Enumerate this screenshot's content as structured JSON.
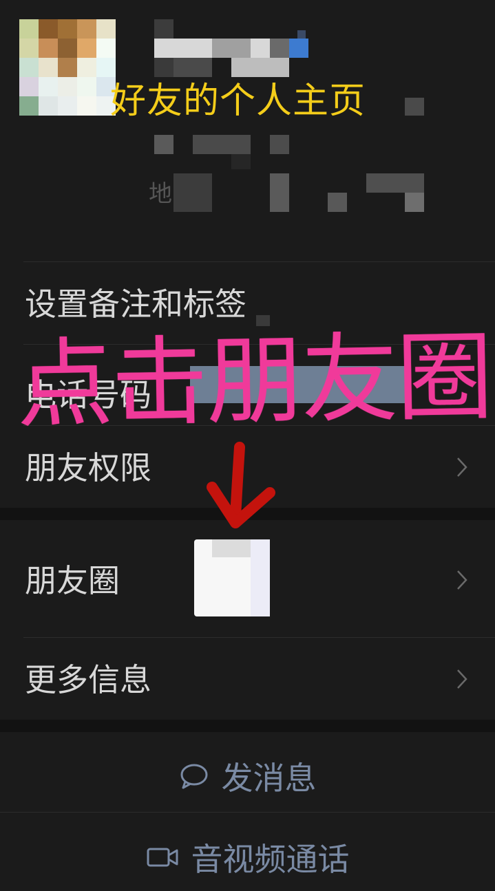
{
  "header": {
    "title": "好友的个人主页",
    "region_label_partial": "地"
  },
  "rows": {
    "remark_tags": "设置备注和标签",
    "phone": "电话号码",
    "friend_permissions": "朋友权限",
    "moments": "朋友圈",
    "more_info": "更多信息"
  },
  "overlay": {
    "instruction": "点击朋友圈"
  },
  "actions": {
    "message": "发消息",
    "call": "音视频通话"
  },
  "colors": {
    "background": "#1b1b1b",
    "header_title": "#f4cd1a",
    "overlay_text": "#f03a9a",
    "arrow": "#c4130d",
    "action_text": "#7a8aa4"
  },
  "icons": {
    "arrow": "down-arrow-icon",
    "chevron": "chevron-right-icon",
    "message": "chat-bubble-icon",
    "call": "video-camera-icon"
  }
}
